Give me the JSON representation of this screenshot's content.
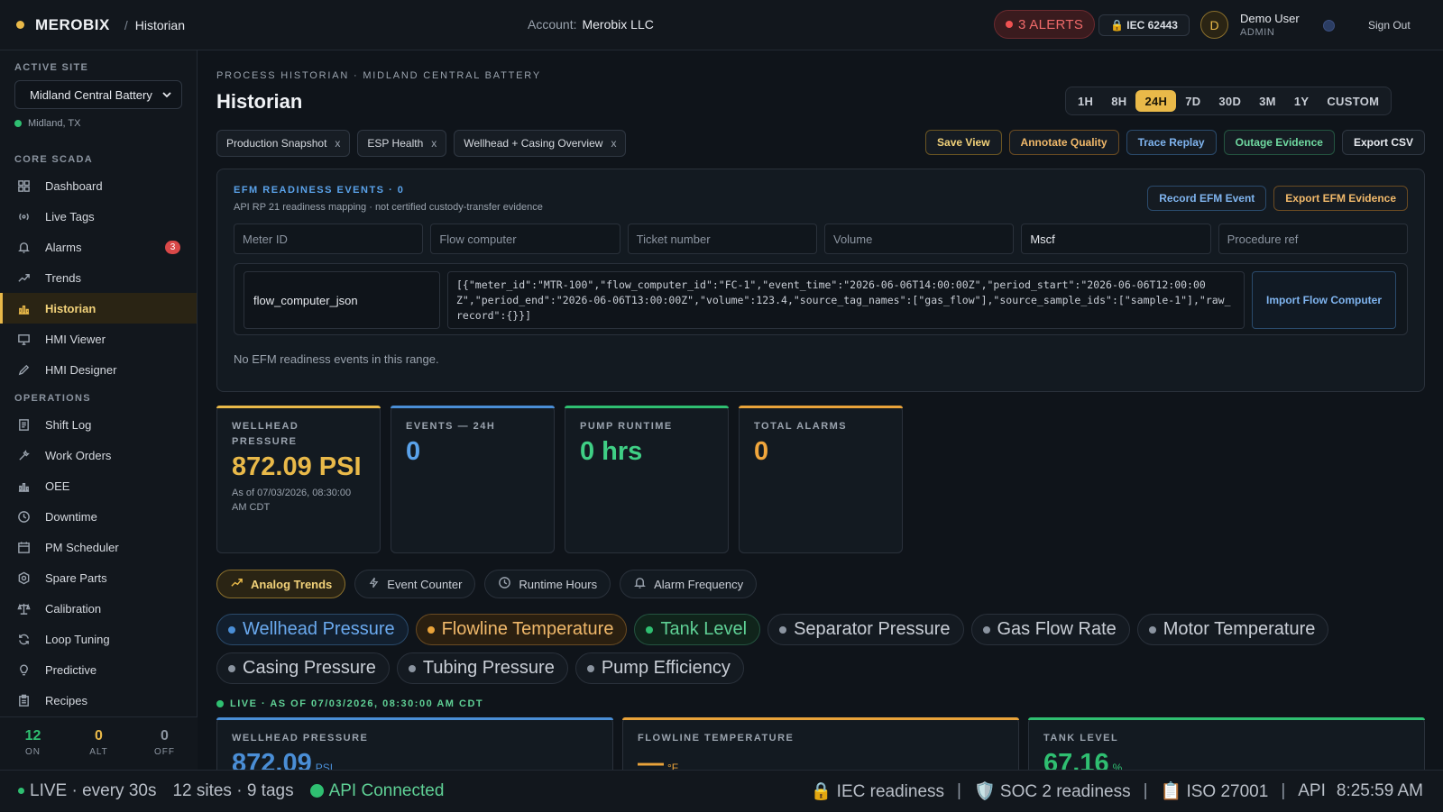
{
  "header": {
    "brand": "MEROBIX",
    "crumb_sep": "/",
    "crumb": "Historian",
    "account_label": "Account:",
    "account_name": "Merobix LLC",
    "alerts": "3 ALERTS",
    "iec": "🔒 IEC 62443",
    "avatar": "D",
    "user_name": "Demo User",
    "user_role": "ADMIN",
    "sign_out": "Sign Out"
  },
  "sidebar": {
    "active_site_label": "ACTIVE SITE",
    "site": "Midland Central Battery",
    "location": "Midland, TX",
    "core_label": "CORE SCADA",
    "core_items": [
      {
        "label": "Dashboard",
        "icon": "grid-icon"
      },
      {
        "label": "Live Tags",
        "icon": "broadcast-icon"
      },
      {
        "label": "Alarms",
        "icon": "bell-icon",
        "badge": "3"
      },
      {
        "label": "Trends",
        "icon": "trend-icon"
      },
      {
        "label": "Historian",
        "icon": "bar-chart-icon",
        "active": true
      },
      {
        "label": "HMI Viewer",
        "icon": "monitor-icon"
      },
      {
        "label": "HMI Designer",
        "icon": "pencil-icon"
      }
    ],
    "ops_label": "OPERATIONS",
    "ops_items": [
      {
        "label": "Shift Log",
        "icon": "document-icon"
      },
      {
        "label": "Work Orders",
        "icon": "wrench-icon"
      },
      {
        "label": "OEE",
        "icon": "bar-chart-icon"
      },
      {
        "label": "Downtime",
        "icon": "clock-icon"
      },
      {
        "label": "PM Scheduler",
        "icon": "calendar-icon"
      },
      {
        "label": "Spare Parts",
        "icon": "gear-icon"
      },
      {
        "label": "Calibration",
        "icon": "scale-icon"
      },
      {
        "label": "Loop Tuning",
        "icon": "refresh-icon"
      },
      {
        "label": "Predictive",
        "icon": "lightbulb-icon"
      },
      {
        "label": "Recipes",
        "icon": "clipboard-icon"
      }
    ],
    "stats": [
      {
        "value": "12",
        "label": "ON",
        "color": "#2fbf71"
      },
      {
        "value": "0",
        "label": "ALT",
        "color": "#e9b949"
      },
      {
        "value": "0",
        "label": "OFF",
        "color": "#8b94a0"
      }
    ]
  },
  "main": {
    "kicker": "PROCESS HISTORIAN · MIDLAND CENTRAL BATTERY",
    "title": "Historian",
    "ranges": [
      "1H",
      "8H",
      "24H",
      "7D",
      "30D",
      "3M",
      "1Y",
      "CUSTOM"
    ],
    "selected_range": "24H",
    "view_chips": [
      "Production Snapshot",
      "ESP Health",
      "Wellhead + Casing Overview"
    ],
    "chip_close": "x",
    "actions": [
      {
        "label": "Save View",
        "style": "y"
      },
      {
        "label": "Annotate Quality",
        "style": "o"
      },
      {
        "label": "Trace Replay",
        "style": "b"
      },
      {
        "label": "Outage Evidence",
        "style": "g"
      },
      {
        "label": "Export CSV",
        "style": "w"
      }
    ]
  },
  "efm": {
    "title": "EFM READINESS EVENTS · 0",
    "subtitle": "API RP 21 readiness mapping · not certified custody-transfer evidence",
    "record_btn": "Record EFM Event",
    "export_btn": "Export EFM Evidence",
    "fields": [
      {
        "placeholder": "Meter ID",
        "value": ""
      },
      {
        "placeholder": "Flow computer",
        "value": ""
      },
      {
        "placeholder": "Ticket number",
        "value": ""
      },
      {
        "placeholder": "Volume",
        "value": ""
      },
      {
        "placeholder": "",
        "value": "Mscf"
      },
      {
        "placeholder": "Procedure ref",
        "value": ""
      }
    ],
    "import_type": "flow_computer_json",
    "import_json": "[{\"meter_id\":\"MTR-100\",\"flow_computer_id\":\"FC-1\",\"event_time\":\"2026-06-06T14:00:00Z\",\"period_start\":\"2026-06-06T12:00:00Z\",\"period_end\":\"2026-06-06T13:00:00Z\",\"volume\":123.4,\"source_tag_names\":[\"gas_flow\"],\"source_sample_ids\":[\"sample-1\"],\"raw_record\":{}}]",
    "import_btn": "Import Flow Computer",
    "empty": "No EFM readiness events in this range."
  },
  "kpis": [
    {
      "label": "WELLHEAD PRESSURE",
      "value": "872.09 PSI",
      "sub": "As of 07/03/2026, 08:30:00 AM CDT",
      "color": "#e9b949"
    },
    {
      "label": "EVENTS — 24H",
      "value": "0",
      "sub": "",
      "color": "#5aa2ea"
    },
    {
      "label": "PUMP RUNTIME",
      "value": "0 hrs",
      "sub": "",
      "color": "#3fcf85"
    },
    {
      "label": "TOTAL ALARMS",
      "value": "0",
      "sub": "",
      "color": "#f0a63c"
    }
  ],
  "view_tabs": [
    {
      "label": "Analog Trends",
      "icon": "trend-icon",
      "active": true
    },
    {
      "label": "Event Counter",
      "icon": "bolt-icon"
    },
    {
      "label": "Runtime Hours",
      "icon": "clock-icon"
    },
    {
      "label": "Alarm Frequency",
      "icon": "bell-icon"
    }
  ],
  "series": [
    {
      "label": "Wellhead Pressure",
      "style": "s1"
    },
    {
      "label": "Flowline Temperature",
      "style": "s2"
    },
    {
      "label": "Tank Level",
      "style": "s3"
    },
    {
      "label": "Separator Pressure",
      "style": ""
    },
    {
      "label": "Gas Flow Rate",
      "style": ""
    },
    {
      "label": "Motor Temperature",
      "style": ""
    },
    {
      "label": "Casing Pressure",
      "style": ""
    },
    {
      "label": "Tubing Pressure",
      "style": ""
    },
    {
      "label": "Pump Efficiency",
      "style": ""
    }
  ],
  "live": "LIVE · AS OF 07/03/2026, 08:30:00 AM CDT",
  "cards": [
    {
      "label": "WELLHEAD PRESSURE",
      "value": "872.09",
      "unit": "PSI",
      "color": "#4a8ed6"
    },
    {
      "label": "FLOWLINE TEMPERATURE",
      "value": "—",
      "unit": "°F",
      "color": "#e9a33a"
    },
    {
      "label": "TANK LEVEL",
      "value": "67.16",
      "unit": "%",
      "color": "#2fbf71"
    }
  ],
  "footer": {
    "live": "LIVE · every 30s",
    "sites": "12 sites · 9 tags",
    "api": "API Connected",
    "iec": "🔒 IEC readiness",
    "soc": "🛡️ SOC 2 readiness",
    "iso": "📋 ISO 27001",
    "api_label": "API",
    "time": "8:25:59 AM",
    "sep": "|"
  }
}
